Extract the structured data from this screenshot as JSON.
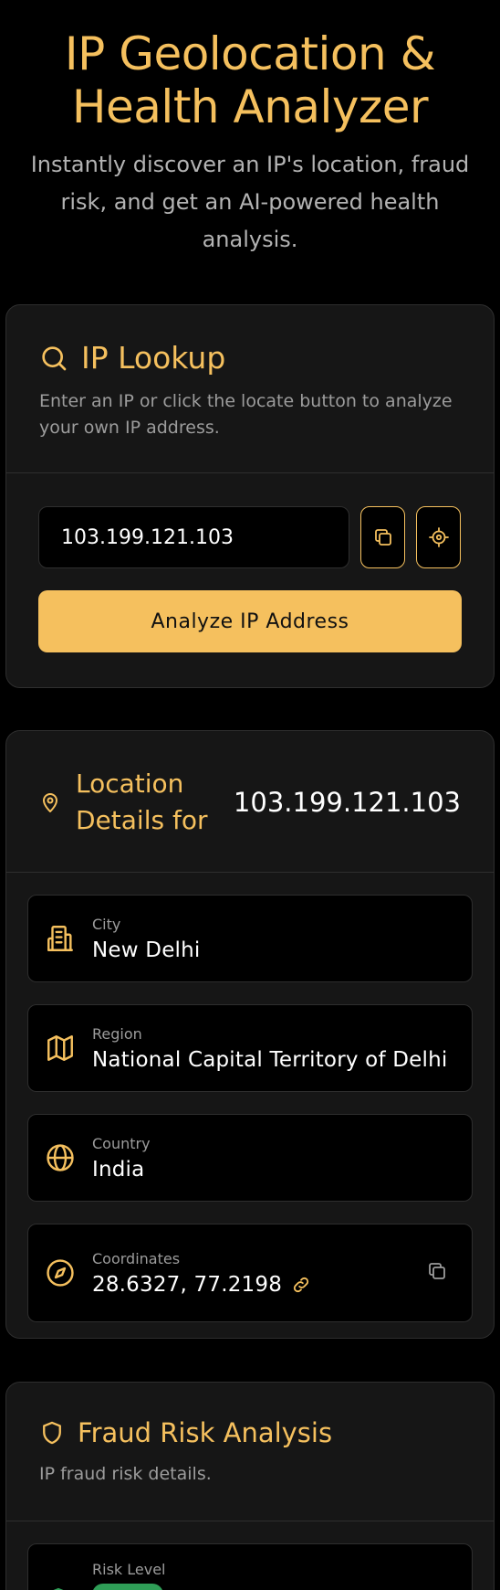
{
  "hero": {
    "title_line1": "IP Geolocation &",
    "title_line2": "Health Analyzer",
    "subtitle": "Instantly discover an IP's location, fraud risk, and get an AI-powered health analysis."
  },
  "lookup": {
    "title": "IP Lookup",
    "description": "Enter an IP or click the locate button to analyze your own IP address.",
    "ip_value": "103.199.121.103",
    "analyze_label": "Analyze IP Address"
  },
  "location": {
    "title": "Location Details for",
    "ip": "103.199.121.103",
    "city_label": "City",
    "city_value": "New Delhi",
    "region_label": "Region",
    "region_value": "National Capital Territory of Delhi",
    "country_label": "Country",
    "country_value": "India",
    "coords_label": "Coordinates",
    "coords_value": "28.6327, 77.2198"
  },
  "fraud": {
    "title": "Fraud Risk Analysis",
    "description": "IP fraud risk details.",
    "risk_label": "Risk Level"
  },
  "colors": {
    "accent": "#f5c05e",
    "card_bg": "#161616",
    "risk_green": "#2f9e57"
  }
}
